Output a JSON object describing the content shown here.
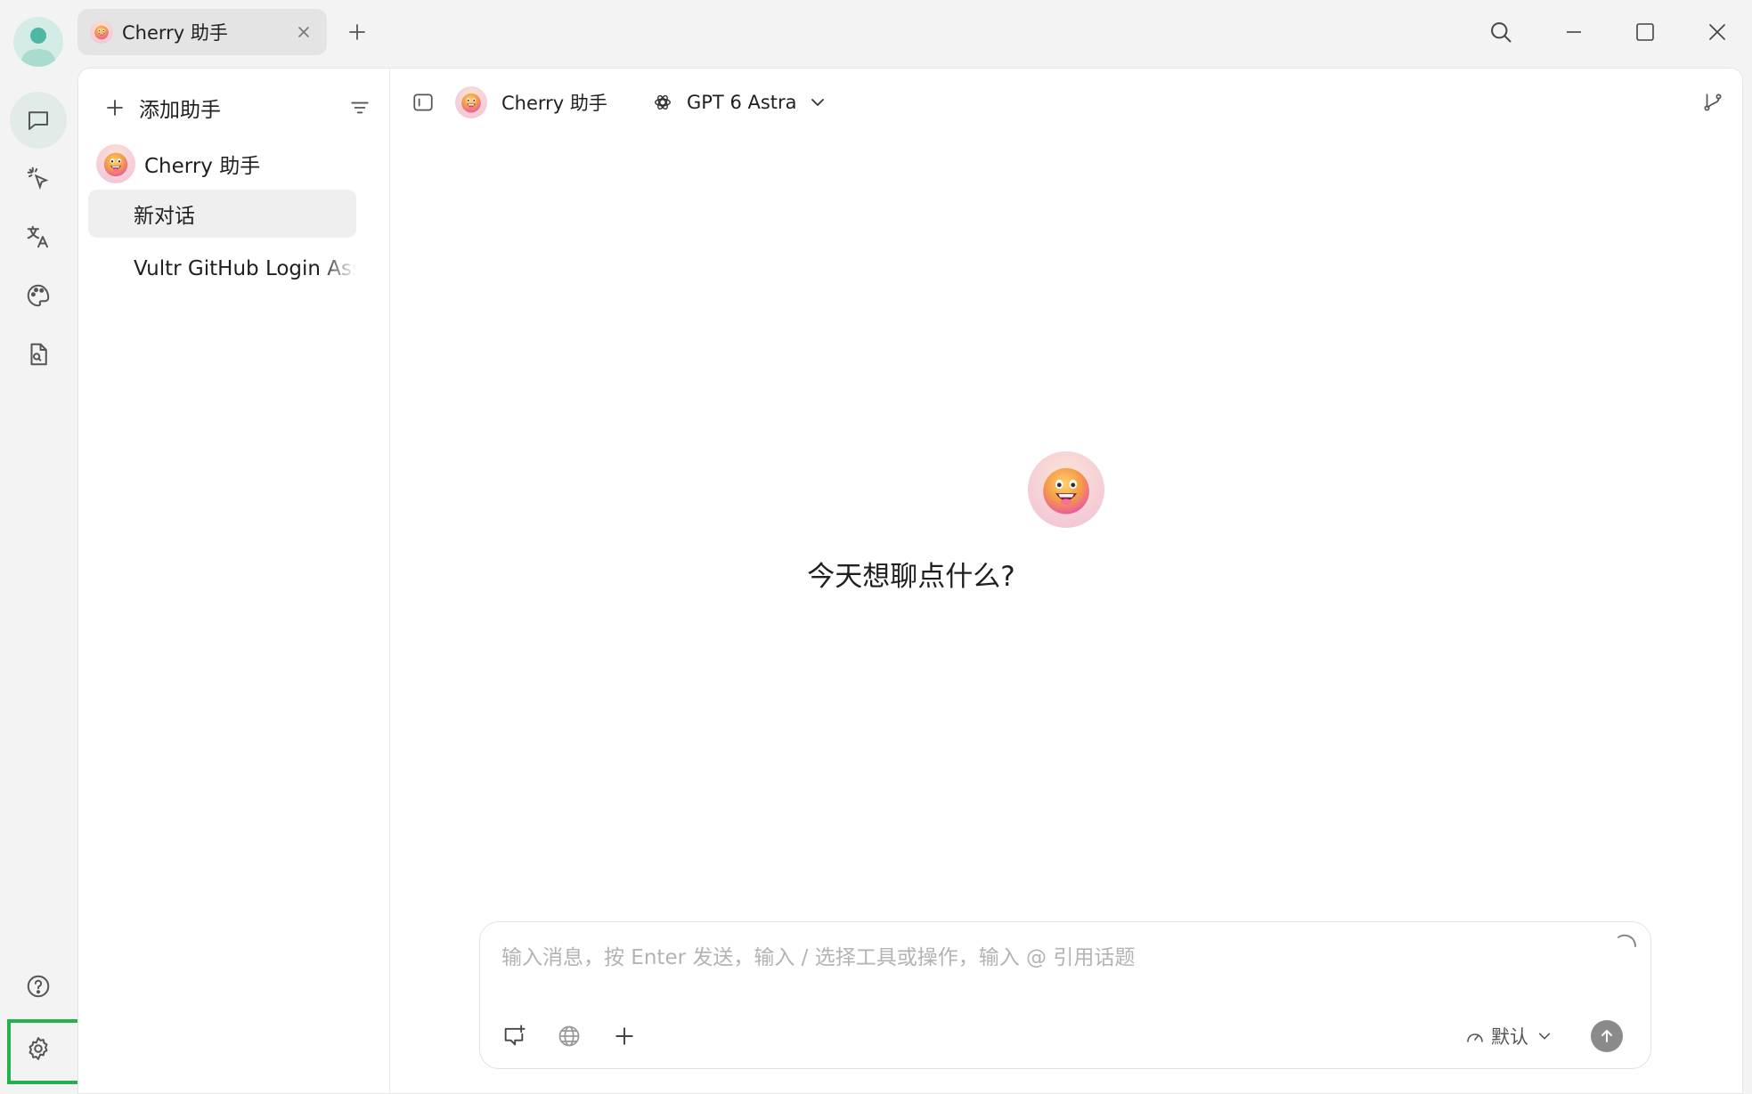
{
  "window": {
    "tab_label": "Cherry 助手"
  },
  "sidebar": {
    "add_assistant_label": "添加助手",
    "assistant_name": "Cherry 助手",
    "topics": [
      {
        "label": "新对话",
        "active": true
      },
      {
        "label": "Vultr GitHub Login Assistant",
        "active": false
      }
    ]
  },
  "header": {
    "assistant_name": "Cherry 助手",
    "model_name": "GPT 6 Astra"
  },
  "welcome": {
    "prompt": "今天想聊点什么?"
  },
  "input": {
    "placeholder": "输入消息，按 Enter 发送，输入 / 选择工具或操作，输入 @ 引用话题",
    "mode_label": "默认"
  },
  "colors": {
    "accent_green": "#22b14c",
    "rail_active": "#e1ece9",
    "user_avatar": "#4fb8a5"
  },
  "icons": {
    "rail": [
      "chat-icon",
      "cursor-click-icon",
      "translate-icon",
      "palette-icon",
      "file-search-icon",
      "help-icon",
      "gear-icon"
    ]
  }
}
